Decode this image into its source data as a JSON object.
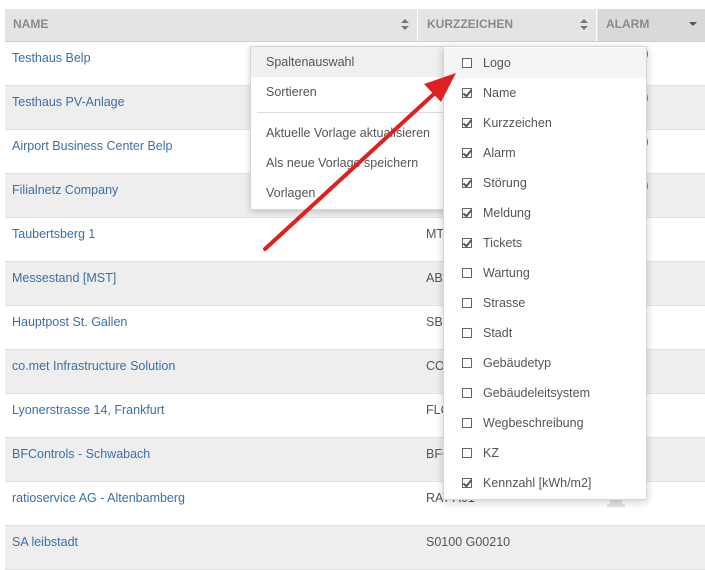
{
  "header": {
    "name": "NAME",
    "kurzzeichen": "KURZZEICHEN",
    "alarm": "ALARM"
  },
  "rows": [
    {
      "name": "Testhaus Belp",
      "code": "",
      "alarm": true
    },
    {
      "name": "Testhaus PV-Anlage",
      "code": "",
      "alarm": true
    },
    {
      "name": "Airport Business Center Belp",
      "code": "",
      "alarm": true
    },
    {
      "name": "Filialnetz Company",
      "code": "",
      "alarm": true
    },
    {
      "name": "Taubertsberg 1",
      "code": "MT",
      "alarm": false
    },
    {
      "name": "Messestand [MST]",
      "code": "ABC",
      "alarm": false
    },
    {
      "name": "Hauptpost St. Gallen",
      "code": "SBC",
      "alarm": false
    },
    {
      "name": "co.met Infrastructure Solution",
      "code": "CO",
      "alarm": false
    },
    {
      "name": "Lyonerstrasse 14, Frankfurt",
      "code": "FLC",
      "alarm": false
    },
    {
      "name": "BFControls - Schwabach",
      "code": "BFC",
      "alarm": false
    },
    {
      "name": "ratioservice AG - Altenbamberg",
      "code": "RAT A01",
      "alarm": false
    },
    {
      "name": "SA leibstadt",
      "code": "S0100 G00210",
      "alarm": false
    }
  ],
  "context_menu": {
    "items": [
      "Spaltenauswahl",
      "Sortieren",
      "Aktuelle Vorlage aktualisieren",
      "Als neue Vorlage speichern",
      "Vorlagen"
    ]
  },
  "columns_menu": {
    "items": [
      {
        "label": "Logo",
        "checked": false
      },
      {
        "label": "Name",
        "checked": true
      },
      {
        "label": "Kurzzeichen",
        "checked": true
      },
      {
        "label": "Alarm",
        "checked": true
      },
      {
        "label": "Störung",
        "checked": true
      },
      {
        "label": "Meldung",
        "checked": true
      },
      {
        "label": "Tickets",
        "checked": true
      },
      {
        "label": "Wartung",
        "checked": false
      },
      {
        "label": "Strasse",
        "checked": false
      },
      {
        "label": "Stadt",
        "checked": false
      },
      {
        "label": "Gebäudetyp",
        "checked": false
      },
      {
        "label": "Gebäudeleitsystem",
        "checked": false
      },
      {
        "label": "Wegbeschreibung",
        "checked": false
      },
      {
        "label": "KZ",
        "checked": false
      },
      {
        "label": "Kennzahl [kWh/m2]",
        "checked": true
      }
    ]
  },
  "colors": {
    "link": "#3d6fa5",
    "alarm": "#d9534f",
    "arrow": "#e02020"
  }
}
